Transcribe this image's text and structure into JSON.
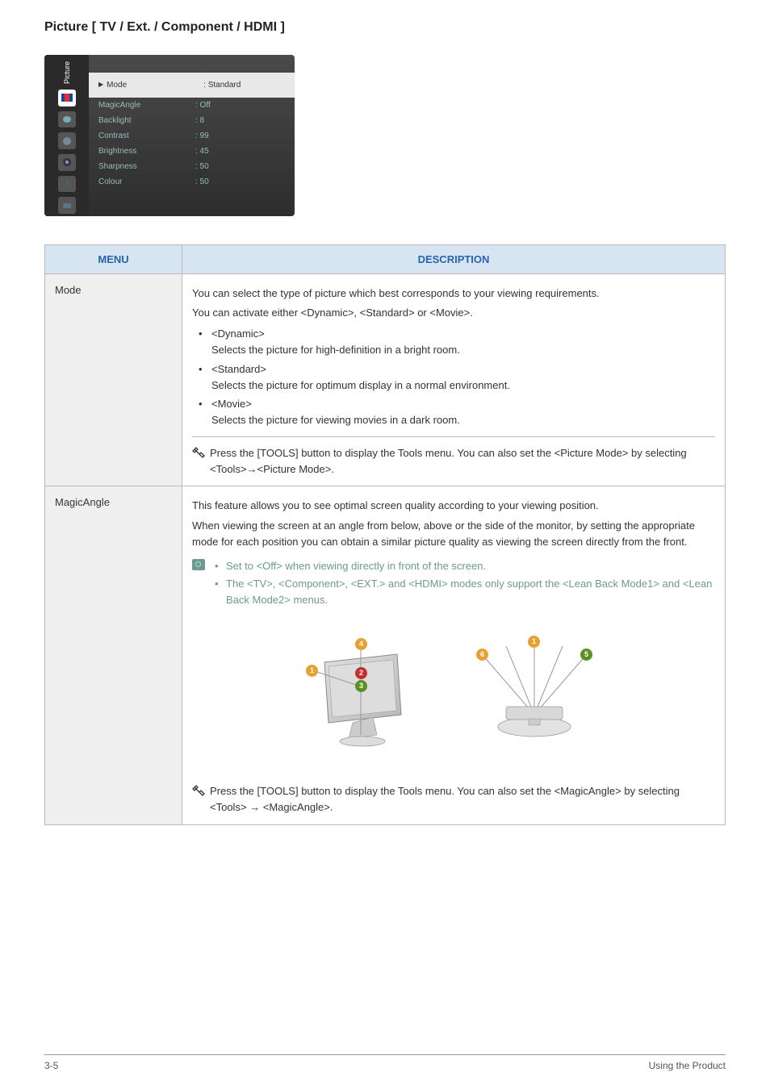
{
  "page_title": "Picture [ TV / Ext. / Component / HDMI ]",
  "osd": {
    "sidebar_label": "Picture",
    "rows": [
      {
        "label": "Mode",
        "value": ": Standard",
        "highlighted": true,
        "marker": "▶"
      },
      {
        "label": "MagicAngle",
        "value": ": Off"
      },
      {
        "label": "Backlight",
        "value": ": 8"
      },
      {
        "label": "Contrast",
        "value": ": 99"
      },
      {
        "label": "Brightness",
        "value": ": 45"
      },
      {
        "label": "Sharpness",
        "value": ": 50"
      },
      {
        "label": "Colour",
        "value": ": 50"
      }
    ]
  },
  "table_header": {
    "menu": "MENU",
    "desc": "DESCRIPTION"
  },
  "mode": {
    "menu_label": "Mode",
    "intro1": "You can select the type of picture which best corresponds to your viewing requirements.",
    "intro2": "You can activate either <Dynamic>, <Standard> or <Movie>.",
    "b1_t": "<Dynamic>",
    "b1_d": "Selects the picture for high-definition in a bright room.",
    "b2_t": "<Standard>",
    "b2_d": "Selects the picture for optimum display in a normal environment.",
    "b3_t": "<Movie>",
    "b3_d": "Selects the picture for viewing movies in a dark room.",
    "tool_note": "Press the [TOOLS] button to display the Tools menu. You can also set the <Picture Mode> by selecting <Tools>→<Picture Mode>."
  },
  "magic": {
    "menu_label": "MagicAngle",
    "p1": "This feature allows you to see optimal screen quality according to your viewing position.",
    "p2": "When viewing the screen at an angle from below, above or the side of the monitor, by setting the appropriate mode for each position you can obtain a similar picture quality as viewing the screen directly from the front.",
    "note1": "Set to <Off> when viewing directly in front of the screen.",
    "note2": "The <TV>, <Component>, <EXT.> and <HDMI> modes only support the <Lean Back Mode1> and <Lean Back Mode2> menus.",
    "tool_note": "Press the [TOOLS] button to display the Tools menu. You can also set the <MagicAngle> by selecting <Tools> → <MagicAngle>.",
    "markers": {
      "1": "1",
      "2": "2",
      "3": "3",
      "4": "4",
      "5": "5",
      "6": "6"
    }
  },
  "footer": {
    "left": "3-5",
    "right": "Using the Product"
  }
}
